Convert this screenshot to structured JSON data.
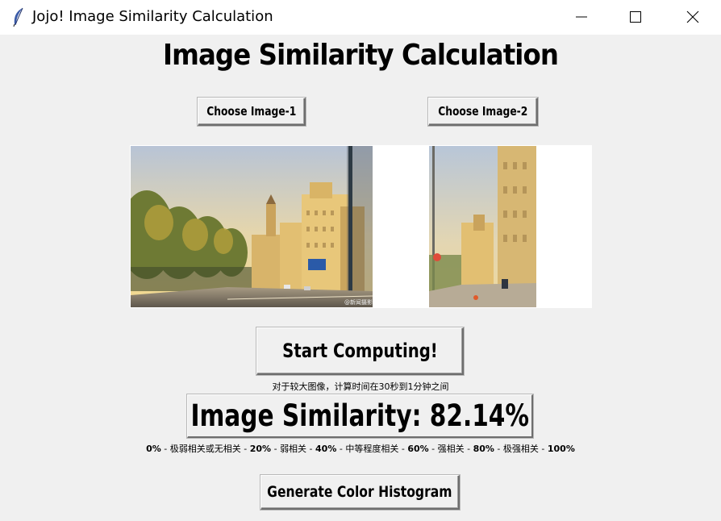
{
  "window": {
    "title": "Jojo! Image Similarity Calculation",
    "icon": "feather-icon",
    "controls": [
      "minimize-icon",
      "maximize-icon",
      "close-icon"
    ]
  },
  "heading": "Image Similarity Calculation",
  "buttons": {
    "choose_image_1": "Choose Image-1",
    "choose_image_2": "Choose Image-2",
    "start": "Start Computing!",
    "histogram": "Generate Color Histogram"
  },
  "images": {
    "image_1_watermark": "@新闻摄影",
    "image_2_watermark": ""
  },
  "note": "对于较大图像，计算时间在30秒到1分钟之间",
  "result": "Image Similarity: 82.14%",
  "scale": {
    "p0": "0%",
    "l0": "极弱相关或无相关",
    "p20": "20%",
    "l20": "弱相关",
    "p40": "40%",
    "l40": "中等程度相关",
    "p60": "60%",
    "l60": "强相关",
    "p80": "80%",
    "l80": "极强相关",
    "p100": "100%"
  },
  "colors": {
    "window_bg": "#f0f0f0",
    "titlebar_bg": "#ffffff",
    "text": "#000000"
  }
}
